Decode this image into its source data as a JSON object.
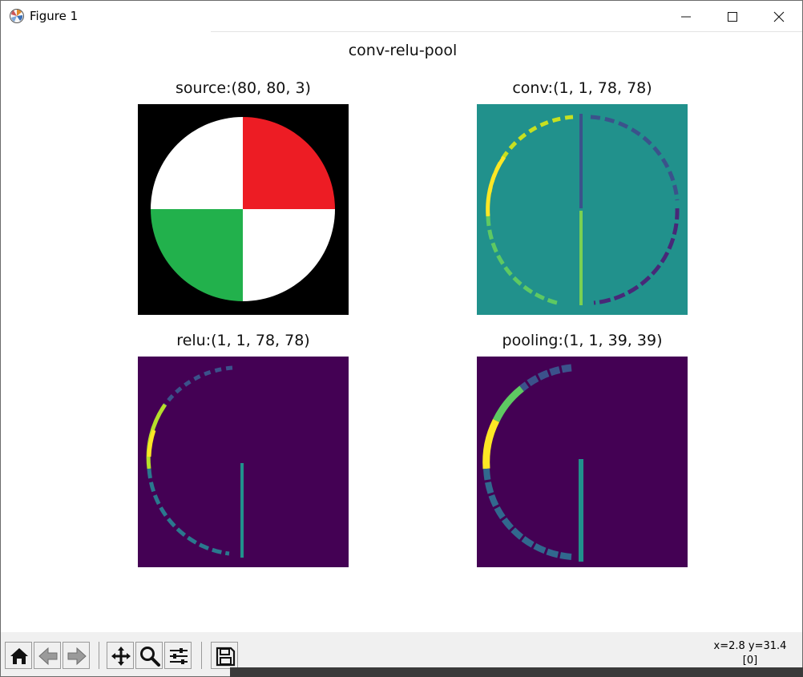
{
  "window": {
    "title": "Figure 1"
  },
  "figure": {
    "suptitle": "conv-relu-pool",
    "panels": [
      {
        "title": "source:(80, 80, 3)"
      },
      {
        "title": "conv:(1, 1, 78, 78)"
      },
      {
        "title": "relu:(1, 1, 78, 78)"
      },
      {
        "title": "pooling:(1, 1, 39, 39)"
      }
    ]
  },
  "colors": {
    "source_bg": "#000000",
    "source_white": "#ffffff",
    "source_red": "#ed1c24",
    "source_green": "#22b14c",
    "viridis_min": "#440154",
    "viridis_dark": "#3b528b",
    "viridis_mid": "#21918c",
    "viridis_light": "#5ec962",
    "viridis_max": "#fde725"
  },
  "toolbar": {
    "buttons": [
      "home-icon",
      "back-arrow-icon",
      "forward-arrow-icon",
      "pan-icon",
      "zoom-icon",
      "configure-subplots-icon",
      "save-icon"
    ],
    "coords": "x=2.8 y=31.4",
    "pixel_value": "[0]"
  }
}
